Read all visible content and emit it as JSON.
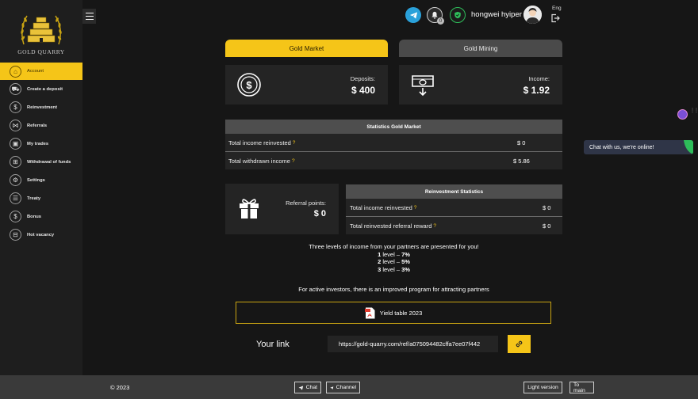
{
  "sidebar": {
    "logo_text": "GOLD QUARRY",
    "items": [
      {
        "label": "Account",
        "icon": "home-icon",
        "glyph": "⌂",
        "active": true
      },
      {
        "label": "Create a deposit",
        "icon": "car-icon",
        "glyph": "⛟",
        "active": false
      },
      {
        "label": "Reinvestment",
        "icon": "dollar-icon",
        "glyph": "$",
        "active": false
      },
      {
        "label": "Referrals",
        "icon": "share-icon",
        "glyph": "⋈",
        "active": false
      },
      {
        "label": "My trades",
        "icon": "shop-icon",
        "glyph": "▣",
        "active": false
      },
      {
        "label": "Withdrawal of funds",
        "icon": "money-icon",
        "glyph": "⊞",
        "active": false
      },
      {
        "label": "Settings",
        "icon": "gear-icon",
        "glyph": "⚙",
        "active": false
      },
      {
        "label": "Treaty",
        "icon": "document-icon",
        "glyph": "☰",
        "active": false
      },
      {
        "label": "Bonus",
        "icon": "coin-icon",
        "glyph": "$",
        "active": false
      },
      {
        "label": "Hot vacancy",
        "icon": "briefcase-icon",
        "glyph": "⊟",
        "active": false
      }
    ]
  },
  "header": {
    "username": "hongwei hyiper",
    "lang": "Eng",
    "bell_badge": "0"
  },
  "tabs": {
    "gold": "Gold Market",
    "mining": "Gold Mining"
  },
  "cards": {
    "deposits_label": "Deposits:",
    "deposits_value": "$ 400",
    "income_label": "Income:",
    "income_value": "$ 1.92"
  },
  "stats_gold": {
    "title": "Statistics Gold Market",
    "rows": [
      {
        "label": "Total income reinvested",
        "value": "$ 0"
      },
      {
        "label": "Total withdrawn income",
        "value": "$ 5.86"
      }
    ]
  },
  "referral": {
    "label": "Referral points:",
    "value": "$ 0"
  },
  "reinvest_stats": {
    "title": "Reinvestment Statistics",
    "rows": [
      {
        "label": "Total income reinvested",
        "value": "$ 0"
      },
      {
        "label": "Total reinvested referral reward",
        "value": "$ 0"
      }
    ]
  },
  "levels": {
    "intro": "Three levels of income from your partners are presented for you!",
    "items": [
      {
        "num": "1",
        "text": " level – ",
        "pct": "7%"
      },
      {
        "num": "2",
        "text": " level – ",
        "pct": "5%"
      },
      {
        "num": "3",
        "text": " level – ",
        "pct": "3%"
      }
    ]
  },
  "improved_text": "For active investors, there is an improved program for attracting partners",
  "yield_label": "Yield table 2023",
  "ref_link": {
    "label": "Your link",
    "value": "https://gold-quarry.com/ref/a075094482cffa7ee07f442"
  },
  "chat_widget": "Chat with us, we're online!",
  "question_mark": "?",
  "footer": {
    "copyright": "© 2023",
    "chat": "Chat",
    "channel": "Channel",
    "light": "Light version",
    "main": "To main"
  },
  "colors": {
    "accent": "#f5c518",
    "sidebar_bg": "#1e1e1e",
    "page_bg": "#161616",
    "card_bg": "#242424",
    "footer_bg": "#3a3a3a"
  }
}
